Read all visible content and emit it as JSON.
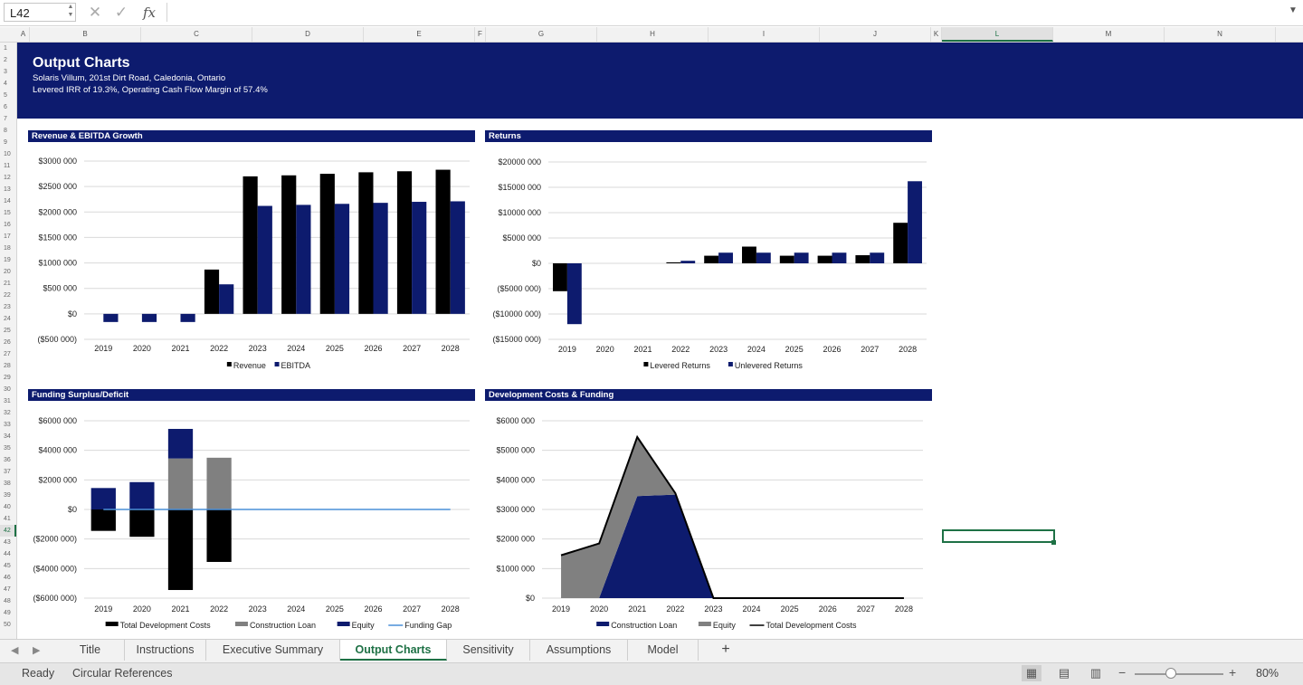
{
  "formula_bar": {
    "name_box": "L42",
    "cancel_icon": "close-icon",
    "enter_icon": "check-icon",
    "fx_label": "fx",
    "formula": ""
  },
  "columns": [
    "A",
    "B",
    "C",
    "D",
    "E",
    "F",
    "G",
    "H",
    "I",
    "J",
    "K",
    "L",
    "M",
    "N"
  ],
  "selected_column": "L",
  "rows": [
    "1",
    "2",
    "3",
    "4",
    "5",
    "6",
    "7",
    "8",
    "9",
    "10",
    "11",
    "12",
    "13",
    "14",
    "15",
    "16",
    "17",
    "18",
    "19",
    "20",
    "21",
    "22",
    "23",
    "24",
    "25",
    "26",
    "27",
    "28",
    "29",
    "30",
    "31",
    "32",
    "33",
    "34",
    "35",
    "36",
    "37",
    "38",
    "39",
    "40",
    "41",
    "42",
    "43",
    "44",
    "45",
    "46",
    "47",
    "48",
    "49",
    "50"
  ],
  "selected_row": "42",
  "banner": {
    "title": "Output Charts",
    "subtitle1": "Solaris Villum, 201st Dirt Road, Caledonia, Ontario",
    "subtitle2": "Levered IRR of 19.3%, Operating Cash Flow Margin of 57.4%"
  },
  "colors": {
    "navy": "#0d1b6e",
    "black": "#000000",
    "gray": "#808080",
    "line_blue": "#4a90d9",
    "excel_green": "#1e7145"
  },
  "sheet_tabs": [
    "Title",
    "Instructions",
    "Executive Summary",
    "Output Charts",
    "Sensitivity",
    "Assumptions",
    "Model"
  ],
  "active_tab": "Output Charts",
  "status": {
    "ready": "Ready",
    "circular": "Circular References",
    "zoom": "80%"
  },
  "chart_data": [
    {
      "type": "bar",
      "title": "Revenue & EBITDA Growth",
      "categories": [
        "2019",
        "2020",
        "2021",
        "2022",
        "2023",
        "2024",
        "2025",
        "2026",
        "2027",
        "2028"
      ],
      "ylim": [
        -500000,
        3000000
      ],
      "yticks": [
        -500000,
        0,
        500000,
        1000000,
        1500000,
        2000000,
        2500000,
        3000000
      ],
      "ytick_labels": [
        "($500 000)",
        "$0",
        "$500 000",
        "$1000 000",
        "$1500 000",
        "$2000 000",
        "$2500 000",
        "$3000 000"
      ],
      "series": [
        {
          "name": "Revenue",
          "color": "#000000",
          "values": [
            0,
            0,
            0,
            870000,
            2700000,
            2720000,
            2750000,
            2780000,
            2800000,
            2830000
          ]
        },
        {
          "name": "EBITDA",
          "color": "#0d1b6e",
          "values": [
            -160000,
            -160000,
            -160000,
            580000,
            2120000,
            2140000,
            2160000,
            2180000,
            2200000,
            2210000
          ]
        }
      ],
      "legend": "bottom",
      "grid": true
    },
    {
      "type": "bar",
      "title": "Returns",
      "categories": [
        "2019",
        "2020",
        "2021",
        "2022",
        "2023",
        "2024",
        "2025",
        "2026",
        "2027",
        "2028"
      ],
      "ylim": [
        -15000000,
        20000000
      ],
      "yticks": [
        -15000000,
        -10000000,
        -5000000,
        0,
        5000000,
        10000000,
        15000000,
        20000000
      ],
      "ytick_labels": [
        "($15000 000)",
        "($10000 000)",
        "($5000 000)",
        "$0",
        "$5000 000",
        "$10000 000",
        "$15000 000",
        "$20000 000"
      ],
      "series": [
        {
          "name": "Levered Returns",
          "color": "#000000",
          "values": [
            -5500000,
            0,
            0,
            200000,
            1500000,
            3300000,
            1500000,
            1500000,
            1600000,
            8000000
          ]
        },
        {
          "name": "Unlevered Returns",
          "color": "#0d1b6e",
          "values": [
            -12000000,
            0,
            0,
            500000,
            2100000,
            2100000,
            2100000,
            2100000,
            2100000,
            16200000
          ]
        }
      ],
      "legend": "bottom",
      "grid": true
    },
    {
      "type": "bar",
      "title": "Funding Surplus/Deficit",
      "categories": [
        "2019",
        "2020",
        "2021",
        "2022",
        "2023",
        "2024",
        "2025",
        "2026",
        "2027",
        "2028"
      ],
      "ylim": [
        -6000000,
        6000000
      ],
      "yticks": [
        -6000000,
        -4000000,
        -2000000,
        0,
        2000000,
        4000000,
        6000000
      ],
      "ytick_labels": [
        "($6000 000)",
        "($4000 000)",
        "($2000 000)",
        "$0",
        "$2000 000",
        "$4000 000",
        "$6000 000"
      ],
      "series": [
        {
          "name": "Total Development Costs",
          "color": "#000000",
          "kind": "bar",
          "values": [
            -1450000,
            -1850000,
            -5450000,
            -3550000,
            0,
            0,
            0,
            0,
            0,
            0
          ]
        },
        {
          "name": "Construction Loan",
          "color": "#808080",
          "kind": "bar",
          "values": [
            0,
            0,
            3450000,
            3500000,
            0,
            0,
            0,
            0,
            0,
            0
          ]
        },
        {
          "name": "Equity",
          "color": "#0d1b6e",
          "kind": "bar",
          "values": [
            1450000,
            1850000,
            2000000,
            0,
            0,
            0,
            0,
            0,
            0,
            0
          ]
        },
        {
          "name": "Funding Gap",
          "color": "#4a90d9",
          "kind": "line",
          "values": [
            0,
            0,
            0,
            0,
            0,
            0,
            0,
            0,
            0,
            0
          ]
        }
      ],
      "stacked": true,
      "legend": "bottom",
      "grid": true
    },
    {
      "type": "area",
      "title": "Development Costs & Funding",
      "categories": [
        "2019",
        "2020",
        "2021",
        "2022",
        "2023",
        "2024",
        "2025",
        "2026",
        "2027",
        "2028"
      ],
      "ylim": [
        0,
        6000000
      ],
      "yticks": [
        0,
        1000000,
        2000000,
        3000000,
        4000000,
        5000000,
        6000000
      ],
      "ytick_labels": [
        "$0",
        "$1000 000",
        "$2000 000",
        "$3000 000",
        "$4000 000",
        "$5000 000",
        "$6000 000"
      ],
      "series": [
        {
          "name": "Construction Loan",
          "color": "#0d1b6e",
          "kind": "area",
          "values": [
            0,
            0,
            3450000,
            3500000,
            0,
            0,
            0,
            0,
            0,
            0
          ]
        },
        {
          "name": "Equity",
          "color": "#808080",
          "kind": "area",
          "values": [
            1450000,
            1850000,
            2000000,
            0,
            0,
            0,
            0,
            0,
            0,
            0
          ]
        },
        {
          "name": "Total Development Costs",
          "color": "#000000",
          "kind": "line",
          "values": [
            1450000,
            1850000,
            5450000,
            3550000,
            0,
            0,
            0,
            0,
            0,
            0
          ]
        }
      ],
      "stacked": true,
      "legend": "bottom",
      "grid": true
    }
  ]
}
